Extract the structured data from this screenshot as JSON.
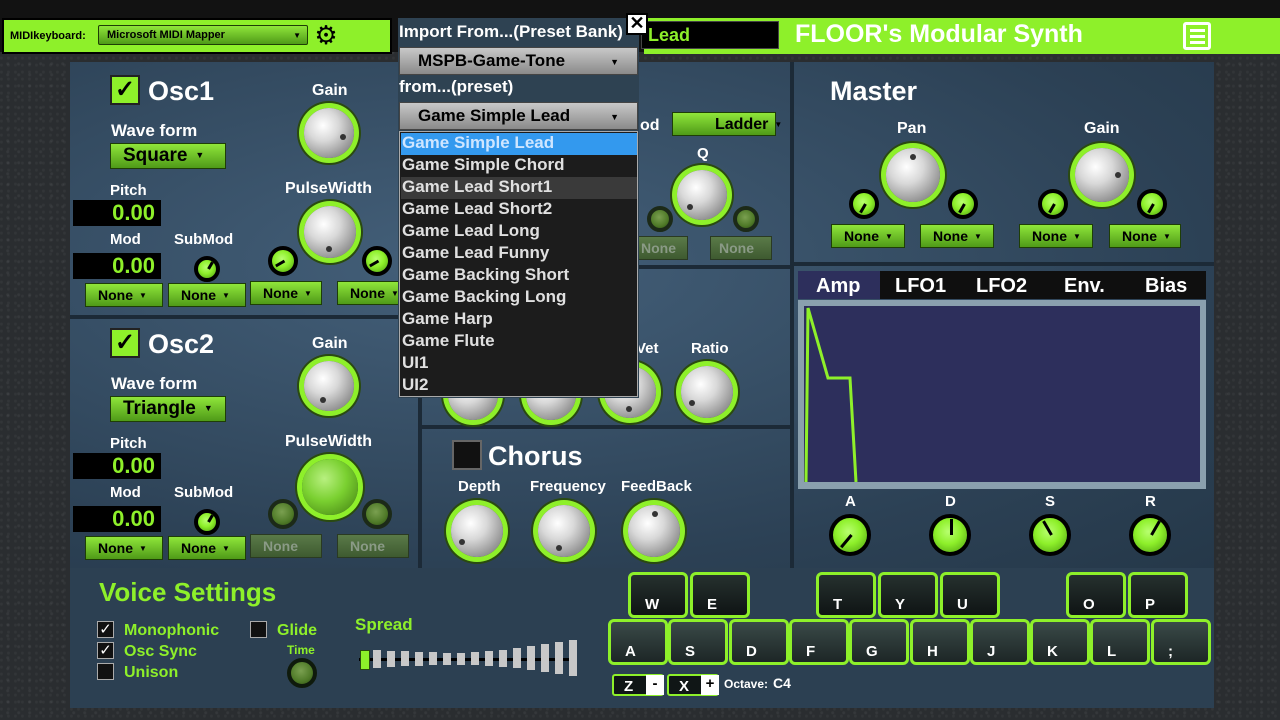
{
  "topbar": {
    "midi_label": "MIDIkeyboard:",
    "midi_device": "Microsoft MIDI Mapper",
    "patch_name": "Lead",
    "app_title": "FLOOR's Modular Synth"
  },
  "osc1": {
    "title": "Osc1",
    "gain_label": "Gain",
    "waveform_label": "Wave form",
    "waveform": "Square",
    "pitch_label": "Pitch",
    "pitch_value": "0.00",
    "mod_label": "Mod",
    "mod_value": "0.00",
    "submod_label": "SubMod",
    "pulsewidth_label": "PulseWidth",
    "mod_sel": "None",
    "submod_sel": "None",
    "pw_sel1": "None",
    "pw_sel2": "None"
  },
  "osc2": {
    "title": "Osc2",
    "gain_label": "Gain",
    "waveform_label": "Wave form",
    "waveform": "Triangle",
    "pitch_label": "Pitch",
    "pitch_value": "0.00",
    "mod_label": "Mod",
    "mod_value": "0.00",
    "submod_label": "SubMod",
    "pulsewidth_label": "PulseWidth",
    "mod_sel": "None",
    "submod_sel": "None",
    "pw_sel1": "None",
    "pw_sel2": "None"
  },
  "filter": {
    "mod_label_partial": "od",
    "mode": "Ladder",
    "q_label": "Q",
    "sel1": "None",
    "sel2": "None"
  },
  "compressor": {
    "wet_label_partial": "Vet",
    "ratio_label": "Ratio"
  },
  "chorus": {
    "title": "Chorus",
    "depth_label": "Depth",
    "frequency_label": "Frequency",
    "feedback_label": "FeedBack"
  },
  "master": {
    "title": "Master",
    "pan_label": "Pan",
    "gain_label": "Gain",
    "pan_sel1": "None",
    "pan_sel2": "None",
    "gain_sel1": "None",
    "gain_sel2": "None"
  },
  "envelope": {
    "tabs": [
      "Amp",
      "LFO1",
      "LFO2",
      "Env.",
      "Bias"
    ],
    "active_tab": "Amp",
    "knob_labels": [
      "A",
      "D",
      "S",
      "R"
    ]
  },
  "voice": {
    "title": "Voice Settings",
    "monophonic_label": "Monophonic",
    "monophonic": true,
    "osc_sync_label": "Osc Sync",
    "osc_sync": true,
    "unison_label": "Unison",
    "unison": false,
    "glide_label": "Glide",
    "glide": false,
    "time_label": "Time",
    "spread_label": "Spread"
  },
  "keyboard": {
    "black_keys": [
      "W",
      "E",
      "T",
      "Y",
      "U",
      "O",
      "P"
    ],
    "white_keys": [
      "A",
      "S",
      "D",
      "F",
      "G",
      "H",
      "J",
      "K",
      "L",
      ";"
    ],
    "octave_down_key": "Z",
    "octave_down_sign": "-",
    "octave_up_key": "X",
    "octave_up_sign": "+",
    "octave_label": "Octave:",
    "octave_value": "C4"
  },
  "dropdown": {
    "import_label": "Import From...(Preset Bank)",
    "bank": "MSPB-Game-Tone",
    "from_label": "from...(preset)",
    "preset": "Game Simple Lead",
    "options": [
      "Game Simple Lead",
      "Game Simple Chord",
      "Game Lead Short1",
      "Game Lead Short2",
      "Game Lead Long",
      "Game Lead Funny",
      "Game Backing Short",
      "Game Backing Long",
      "Game Harp",
      "Game Flute",
      "UI1",
      "UI2"
    ],
    "selected_index": 0,
    "hover_index": 2
  },
  "colors": {
    "accent": "#8ef02a",
    "panel": "#2f4558",
    "envelope_bg": "#2d2f5c",
    "selection": "#3399ee"
  }
}
